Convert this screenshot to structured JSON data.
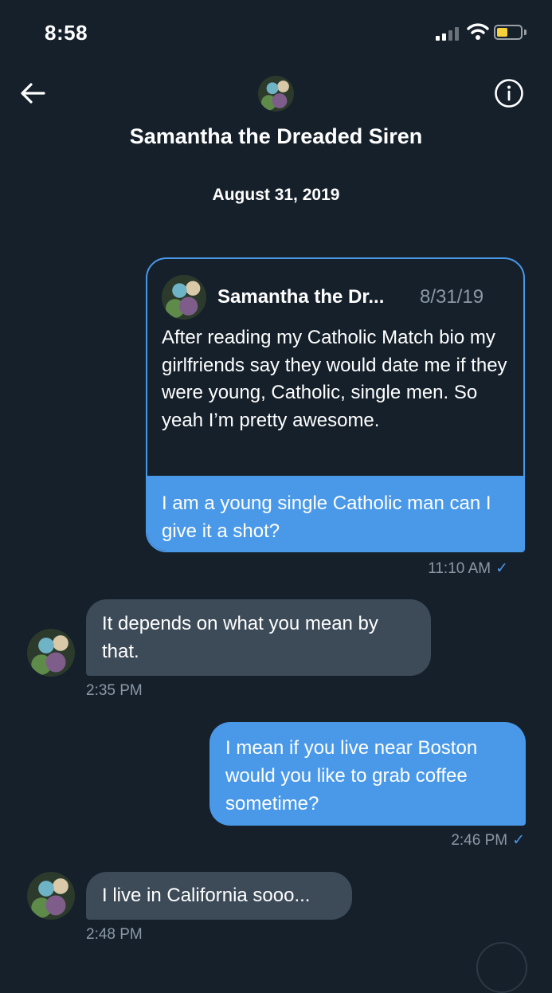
{
  "status_bar": {
    "time": "8:58"
  },
  "header": {
    "title": "Samantha the Dreaded Siren"
  },
  "date_separator": "August 31, 2019",
  "quoted_tweet": {
    "author": "Samantha the Dr...",
    "date": "8/31/19",
    "text": "After reading my Catholic Match bio my girlfriends say they would date me if they were young, Catholic, single men. So yeah I’m pretty awesome.",
    "reply": "I am a young single Catholic man can I give it a shot?",
    "timestamp": "11:10 AM"
  },
  "messages": [
    {
      "side": "received",
      "text": "It depends on what you mean by that.",
      "timestamp": "2:35 PM"
    },
    {
      "side": "sent",
      "text": "I mean if you live near Boston would you like to grab coffee sometime?",
      "timestamp": "2:46 PM"
    },
    {
      "side": "received",
      "text": "I live in California sooo...",
      "timestamp": "2:48 PM"
    }
  ],
  "colors": {
    "background": "#15202b",
    "accent": "#4a99e9",
    "received_bubble": "#3d4b59",
    "muted": "#8b98a5"
  },
  "icons": {
    "back": "arrow-left-icon",
    "info": "info-icon",
    "read": "checkmark-icon"
  }
}
